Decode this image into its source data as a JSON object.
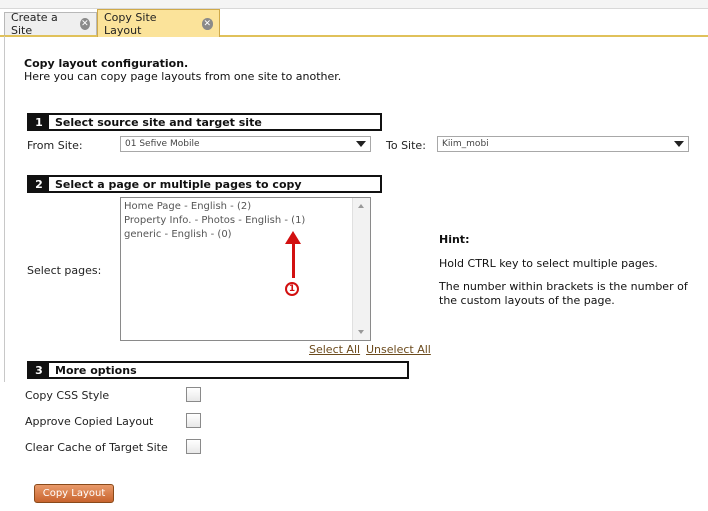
{
  "tabs": [
    {
      "label": "Create a Site",
      "active": false
    },
    {
      "label": "Copy Site Layout",
      "active": true
    }
  ],
  "page": {
    "title": "Copy layout configuration.",
    "subtitle": "Here you can copy page layouts from one site to another."
  },
  "section1": {
    "number": "1",
    "title": "Select source site and target site"
  },
  "from_site": {
    "label": "From Site:",
    "value": "01 Sefive Mobile"
  },
  "to_site": {
    "label": "To Site:",
    "value": "Kiim_mobi"
  },
  "section2": {
    "number": "2",
    "title": "Select a page or multiple pages to copy"
  },
  "select_pages": {
    "label": "Select pages:",
    "items": [
      "Home Page - English - (2)",
      "Property Info. - Photos - English - (1)",
      "generic - English - (0)"
    ]
  },
  "annotation": {
    "marker": "1",
    "color": "#d21010"
  },
  "hint": {
    "title": "Hint:",
    "line1": "Hold CTRL key to select multiple pages.",
    "line2": "The number within brackets is the number of the custom layouts of the page."
  },
  "links": {
    "select_all": "Select All",
    "unselect_all": "Unselect All"
  },
  "section3": {
    "number": "3",
    "title": "More options"
  },
  "options": [
    {
      "label": "Copy CSS Style",
      "checked": false
    },
    {
      "label": "Approve Copied Layout",
      "checked": false
    },
    {
      "label": "Clear Cache of Target Site",
      "checked": false
    }
  ],
  "button": {
    "label": "Copy Layout"
  },
  "colors": {
    "active_tab": "#fbe39a",
    "button": "#d8784a",
    "link": "#6b4a1c"
  }
}
